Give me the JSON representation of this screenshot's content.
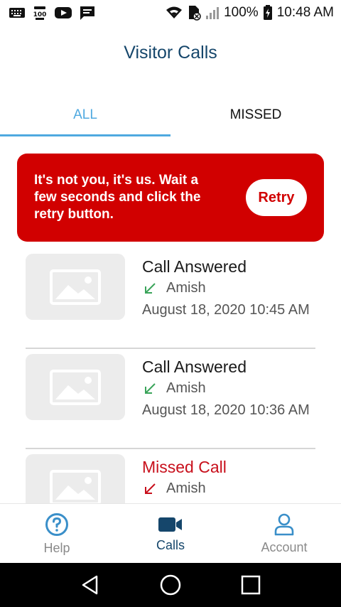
{
  "status_bar": {
    "battery": "100%",
    "time": "10:48 AM",
    "left_icons": [
      "keyboard-icon",
      "notification-100-icon",
      "youtube-icon",
      "message-icon"
    ],
    "right_icons": [
      "wifi-icon",
      "sim-off-icon",
      "signal-icon",
      "battery-charging-icon"
    ]
  },
  "header": {
    "title": "Visitor Calls"
  },
  "tabs": [
    {
      "label": "ALL",
      "active": true
    },
    {
      "label": "MISSED",
      "active": false
    }
  ],
  "banner": {
    "message": "It's not you, it's us. Wait a few seconds and click the retry button.",
    "retry_label": "Retry"
  },
  "calls": [
    {
      "title": "Call Answered",
      "status": "answered",
      "who": "Amish",
      "time": "August 18, 2020 10:45 AM"
    },
    {
      "title": "Call Answered",
      "status": "answered",
      "who": "Amish",
      "time": "August 18, 2020 10:36 AM"
    },
    {
      "title": "Missed Call",
      "status": "missed",
      "who": "Amish",
      "time": ""
    }
  ],
  "bottom_nav": [
    {
      "label": "Help",
      "icon": "help-icon",
      "active": false
    },
    {
      "label": "Calls",
      "icon": "video-camera-icon",
      "active": true
    },
    {
      "label": "Account",
      "icon": "person-icon",
      "active": false
    }
  ],
  "colors": {
    "brand_navy": "#15466b",
    "tab_active": "#4fa9e0",
    "error_red": "#d10000",
    "answered_green": "#3aa45a",
    "missed_red": "#c8101c"
  }
}
